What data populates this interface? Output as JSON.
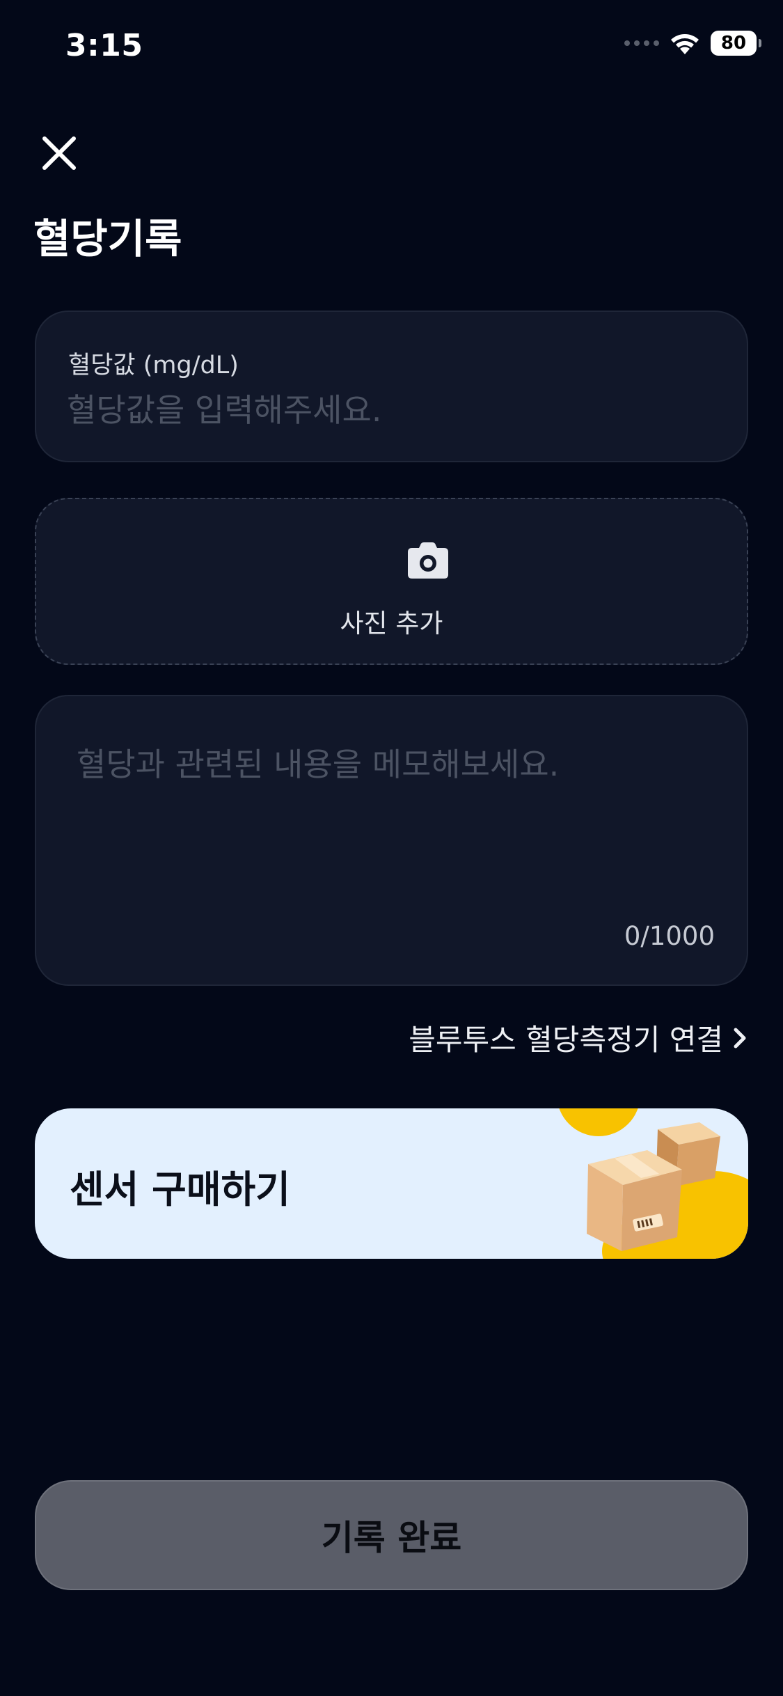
{
  "status_bar": {
    "time": "3:15",
    "battery_level": "80",
    "icons": [
      "signal-dots-icon",
      "wifi-icon",
      "battery-icon"
    ]
  },
  "header": {
    "close_icon": "close-icon",
    "title": "혈당기록"
  },
  "glucose": {
    "label": "혈당값 (mg/dL)",
    "value": "",
    "placeholder": "혈당값을 입력해주세요."
  },
  "photo": {
    "icon": "camera-icon",
    "label": "사진 추가"
  },
  "memo": {
    "value": "",
    "placeholder": "혈당과 관련된 내용을 메모해보세요.",
    "counter": "0/1000"
  },
  "bluetooth_link": {
    "label": "블루투스 혈당측정기 연결",
    "icon": "chevron-right-icon"
  },
  "sensor_banner": {
    "label": "센서 구매하기",
    "image": "cardboard-boxes-illustration"
  },
  "footer": {
    "complete_label": "기록 완료"
  },
  "colors": {
    "background": "#030818",
    "card": "#111729",
    "banner": "#e3f0fe",
    "accent_yellow": "#f8c200",
    "button_disabled": "#5a5d68"
  }
}
